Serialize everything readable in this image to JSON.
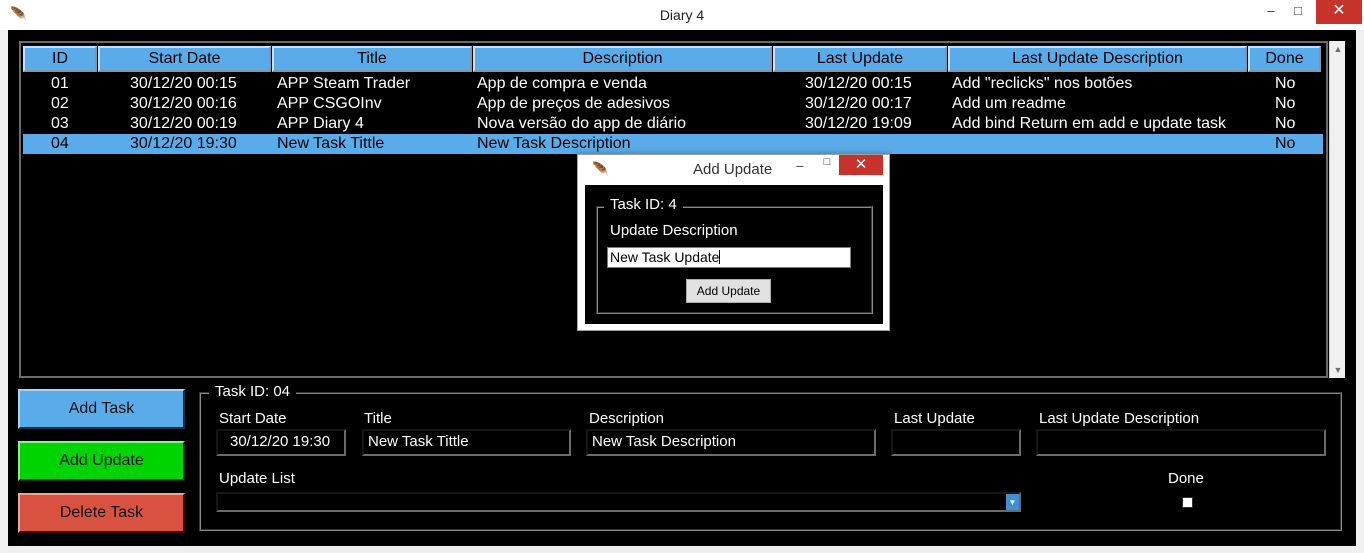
{
  "window": {
    "title": "Diary 4",
    "minimize_glyph": "–",
    "maximize_glyph": "□",
    "close_glyph": "✕",
    "app_icon_glyph": "🪶"
  },
  "table": {
    "columns": [
      "ID",
      "Start Date",
      "Title",
      "Description",
      "Last Update",
      "Last Update Description",
      "Done"
    ],
    "rows": [
      {
        "id": "01",
        "start": "30/12/20  00:15",
        "title": "APP Steam Trader",
        "description": "App de compra e venda",
        "last_update": "30/12/20  00:15",
        "last_update_desc": "Add \"reclicks\" nos botões",
        "done": "No"
      },
      {
        "id": "02",
        "start": "30/12/20  00:16",
        "title": "APP CSGOInv",
        "description": "App de preços de adesivos",
        "last_update": "30/12/20  00:17",
        "last_update_desc": "Add um readme",
        "done": "No"
      },
      {
        "id": "03",
        "start": "30/12/20  00:19",
        "title": "APP Diary 4",
        "description": "Nova versão do app de diário",
        "last_update": "30/12/20  19:09",
        "last_update_desc": "Add bind Return em add e update task",
        "done": "No"
      },
      {
        "id": "04",
        "start": "30/12/20  19:30",
        "title": "New Task Tittle",
        "description": "New Task Description",
        "last_update": "",
        "last_update_desc": "",
        "done": "No"
      }
    ],
    "selected_row": "04"
  },
  "buttons": {
    "add_task": "Add Task",
    "add_update": "Add Update",
    "delete_task": "Delete Task"
  },
  "detail": {
    "frame_title": "Task ID:  04",
    "start_date_label": "Start Date",
    "start_date_value": "30/12/20  19:30",
    "title_label": "Title",
    "title_value": "New Task Tittle",
    "description_label": "Description",
    "description_value": "New Task Description",
    "last_update_label": "Last Update",
    "last_update_value": "",
    "last_update_desc_label": "Last Update Description",
    "last_update_desc_value": "",
    "update_list_label": "Update List",
    "update_list_value": "",
    "done_label": "Done",
    "done_checked": false
  },
  "dialog": {
    "title": "Add Update",
    "frame_title": "Task ID:  4",
    "label": "Update Description",
    "input_value": "New Task Update",
    "button": "Add Update"
  },
  "colors": {
    "accent_blue": "#5aabe9",
    "add_update_green": "#00d400",
    "delete_red": "#d95141",
    "close_red": "#c7322b",
    "app_background": "#000000"
  }
}
